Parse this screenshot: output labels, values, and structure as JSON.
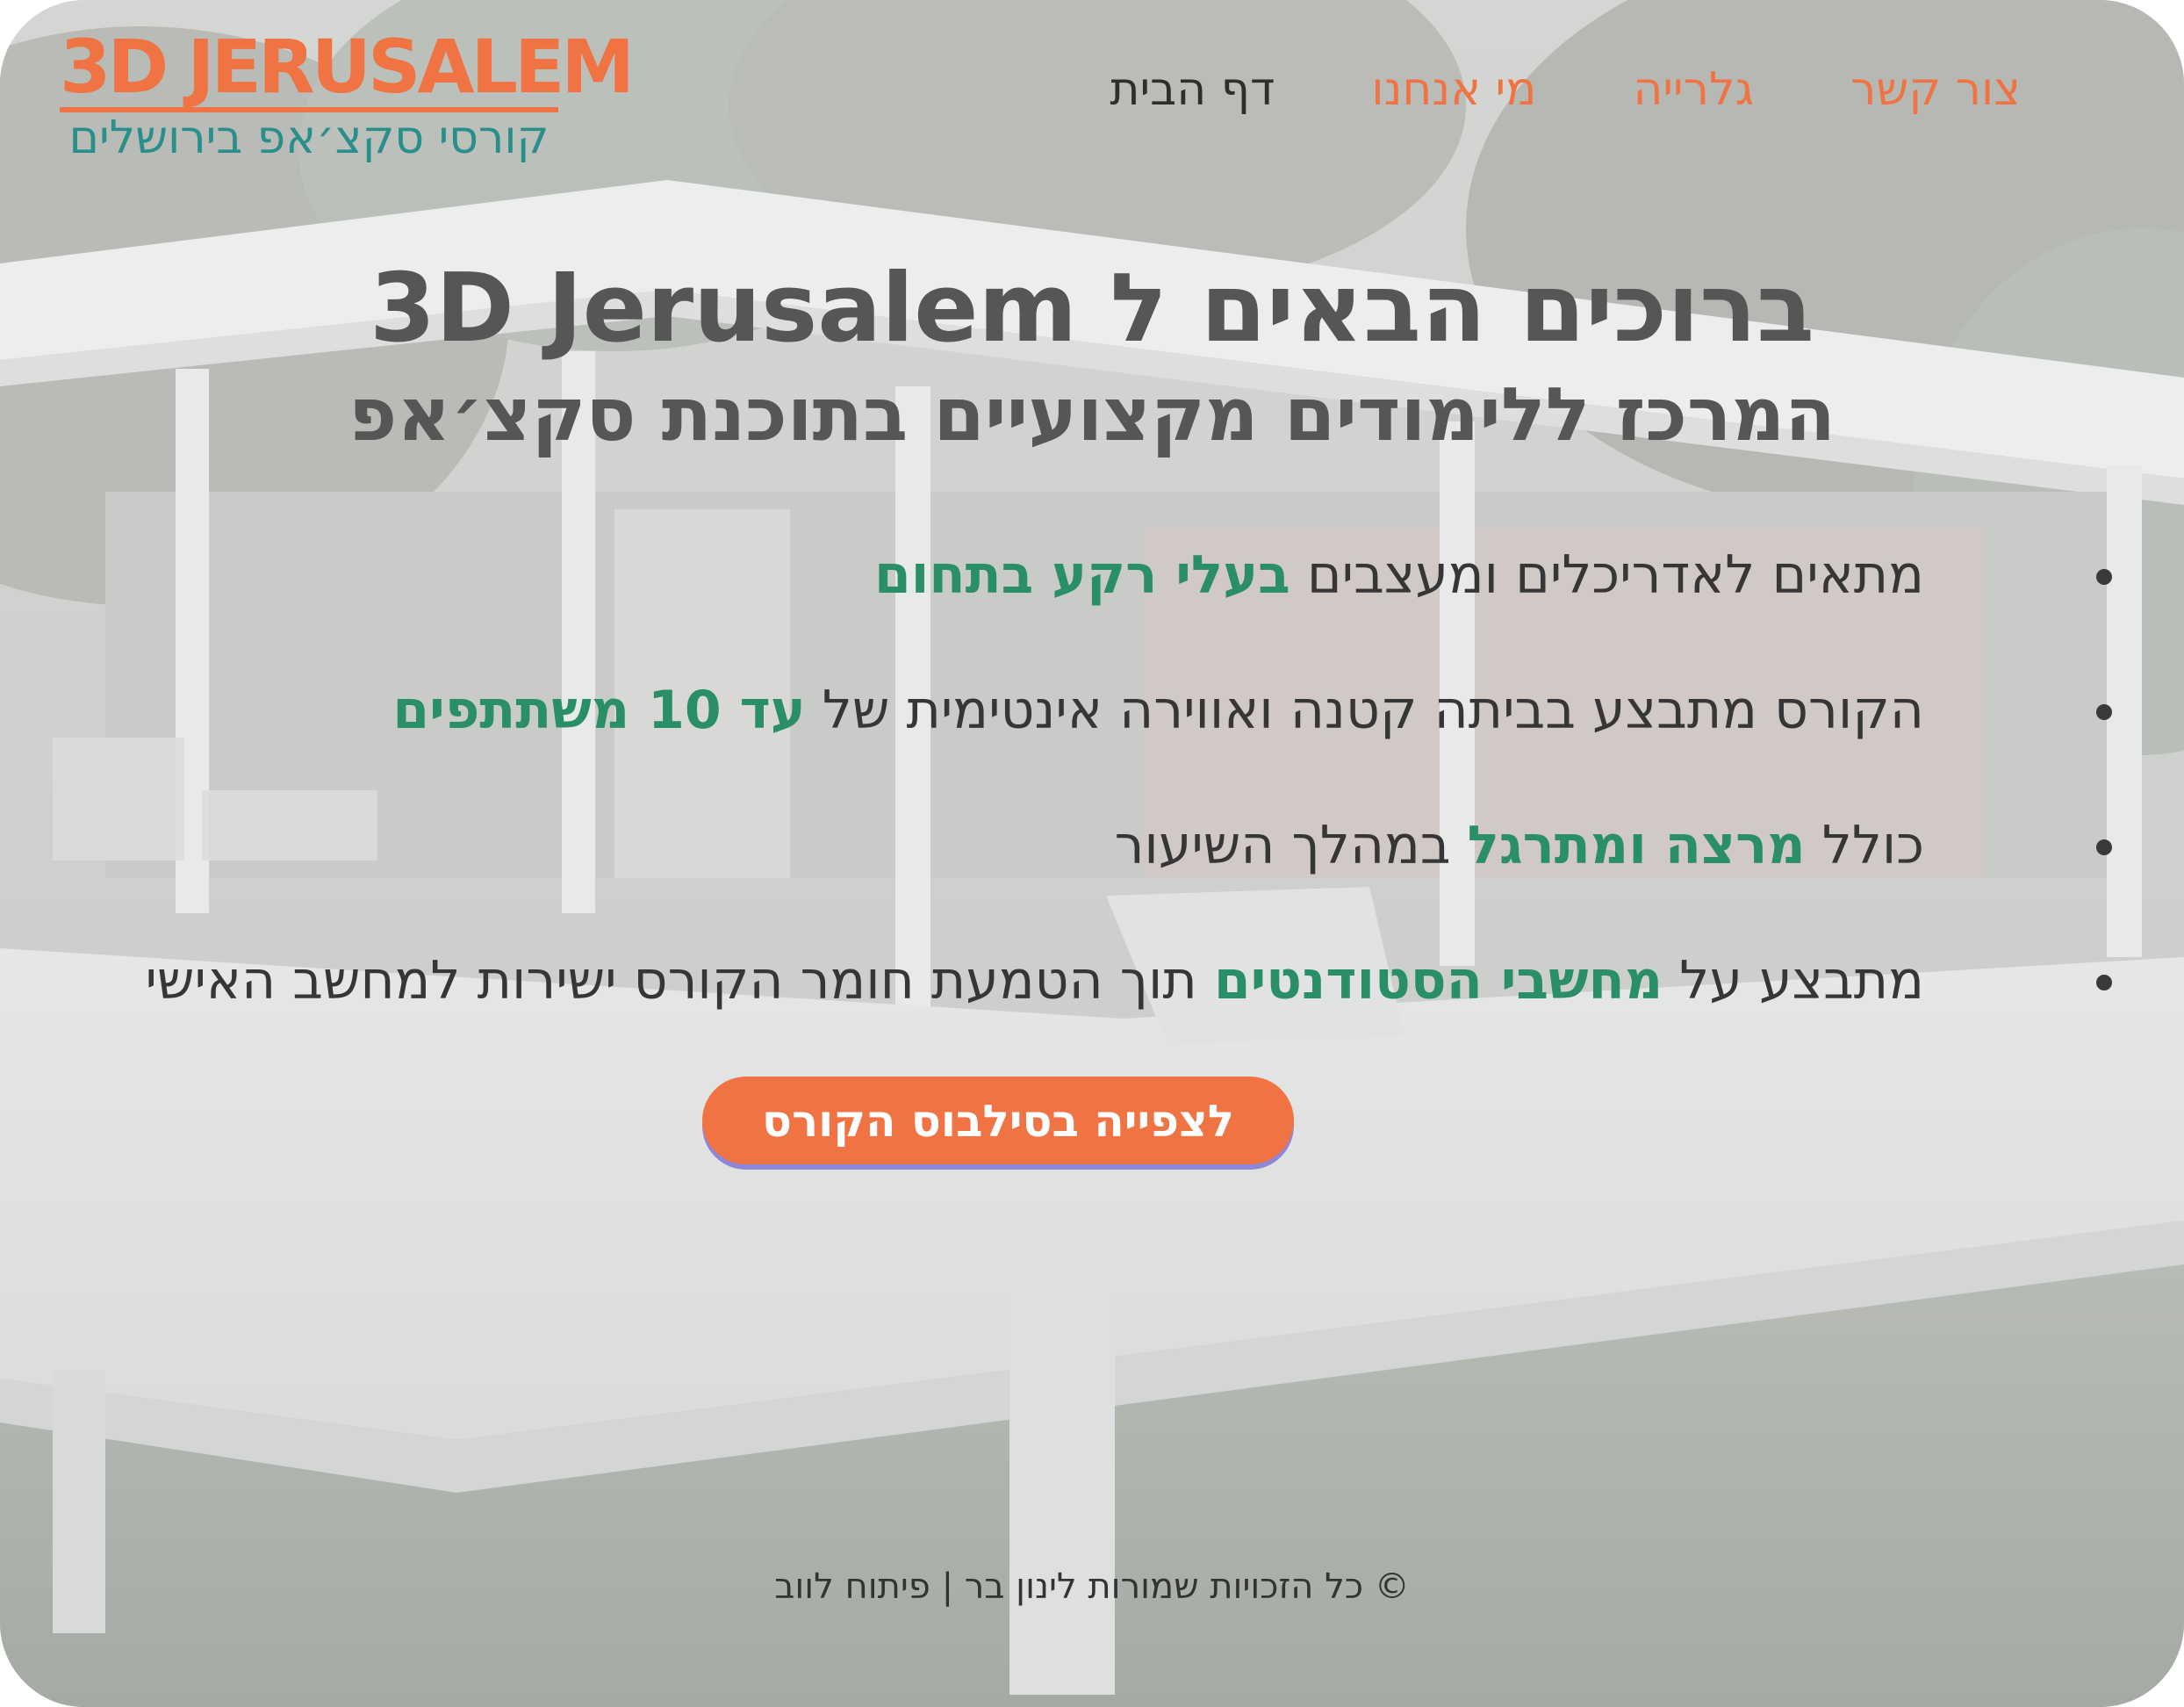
{
  "brand": {
    "logo_title": "3D JERUSALEM",
    "logo_subtitle": "קורסי סקצ׳אפ בירושלים"
  },
  "nav": {
    "items": [
      {
        "label": "דף הבית",
        "active": true
      },
      {
        "label": "מי אנחנו",
        "active": false
      },
      {
        "label": "גלרייה",
        "active": false
      },
      {
        "label": "צור קשר",
        "active": false
      }
    ]
  },
  "hero": {
    "title": "ברוכים הבאים ל 3D Jerusalem",
    "subtitle": "המרכז ללימודים מקצועיים בתוכנת סקצ׳אפ"
  },
  "features": [
    {
      "text": "מתאים לאדריכלים ומעצבים ",
      "highlight": "בעלי רקע בתחום",
      "after": ""
    },
    {
      "text": "הקורס מתבצע בביתה קטנה ואווירה אינטימית של ",
      "highlight": "עד 10 משתתפים",
      "after": ""
    },
    {
      "text": "כולל ",
      "highlight": "מרצה ומתרגל",
      "after": " במהלך השיעור"
    },
    {
      "text": "מתבצע על ",
      "highlight": "מחשבי הסטודנטים",
      "after": " תוך הטמעת חומר הקורס ישירות למחשב האישי"
    }
  ],
  "cta": {
    "label": "לצפייה בסילבוס הקורס"
  },
  "footer": {
    "text": "© כל הזכויות שמורות לינון בר | פיתוח לווב"
  },
  "colors": {
    "accent": "#f07443",
    "teal": "#2a8f8a",
    "highlight": "#2a8f66",
    "text": "#363636"
  }
}
